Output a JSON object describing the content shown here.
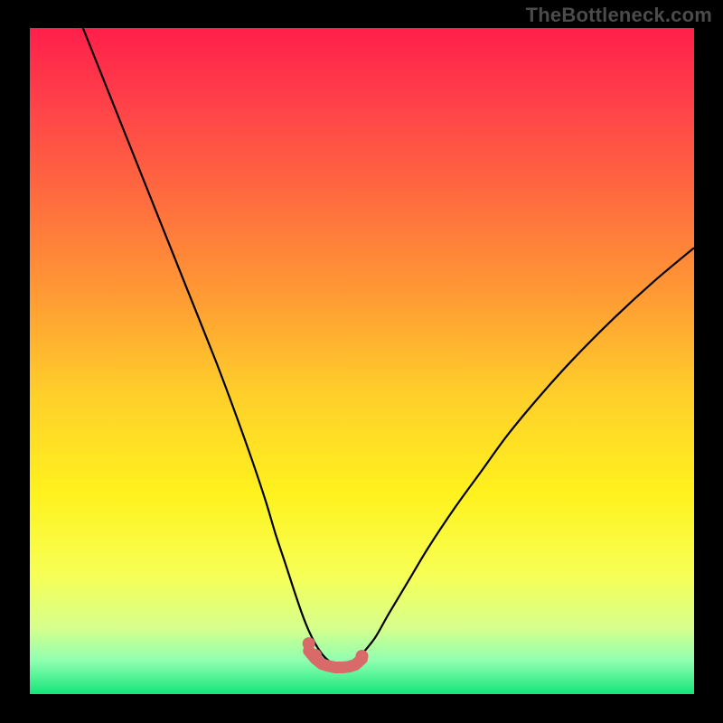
{
  "watermark": "TheBottleneck.com",
  "chart_data": {
    "type": "line",
    "title": "",
    "xlabel": "",
    "ylabel": "",
    "xlim": [
      0,
      100
    ],
    "ylim": [
      0,
      100
    ],
    "grid": false,
    "legend": false,
    "series": [
      {
        "name": "curve",
        "x": [
          8,
          12,
          16,
          20,
          24,
          28,
          31,
          33.5,
          35.5,
          37,
          38.5,
          39.8,
          41,
          42,
          43,
          44,
          45,
          46,
          47,
          48,
          49,
          50,
          52,
          54,
          57,
          60,
          64,
          68,
          72,
          77,
          82,
          88,
          94,
          100
        ],
        "y": [
          100,
          90,
          80,
          70,
          60,
          50,
          42,
          35,
          29,
          24,
          19.5,
          15.5,
          12,
          9.5,
          7.5,
          6,
          5,
          4.5,
          4.3,
          4.4,
          5,
          6,
          8.5,
          12,
          17,
          22,
          28,
          33.5,
          39,
          45,
          50.5,
          56.5,
          62,
          67
        ]
      },
      {
        "name": "flat-marker",
        "x": [
          42,
          43,
          44,
          45,
          46,
          47,
          48,
          49,
          50
        ],
        "y": [
          6.5,
          5.3,
          4.5,
          4.2,
          4.0,
          4.0,
          4.1,
          4.4,
          5.3
        ]
      }
    ],
    "background_gradient": {
      "stops": [
        {
          "offset": 0.0,
          "color": "#ff1f4a"
        },
        {
          "offset": 0.1,
          "color": "#ff3d4a"
        },
        {
          "offset": 0.25,
          "color": "#ff6a3f"
        },
        {
          "offset": 0.4,
          "color": "#ff9a34"
        },
        {
          "offset": 0.55,
          "color": "#ffcf2a"
        },
        {
          "offset": 0.7,
          "color": "#fff21e"
        },
        {
          "offset": 0.82,
          "color": "#f7ff55"
        },
        {
          "offset": 0.9,
          "color": "#d7ff8c"
        },
        {
          "offset": 0.95,
          "color": "#8fffb0"
        },
        {
          "offset": 1.0,
          "color": "#14e57a"
        }
      ]
    },
    "curve_stroke": "#000000",
    "marker_color": "#d86a6a"
  }
}
